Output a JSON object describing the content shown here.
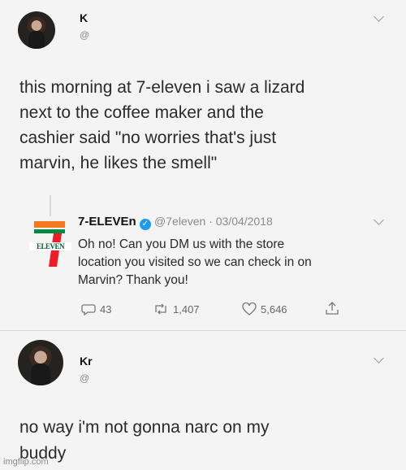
{
  "tweet1": {
    "name": "K",
    "handle": "@",
    "text_lines": [
      "this morning at 7-eleven i saw a lizard",
      "next to the coffee maker and the",
      "cashier said \"no worries that's just",
      "marvin, he likes the smell\""
    ]
  },
  "reply": {
    "logo_text": "ELEVEN",
    "name": "7-ELEVEn",
    "verified_icon": "verified-badge-icon",
    "handle_date": "@7eleven · 03/04/2018",
    "text_lines": [
      "Oh no! Can you DM us with the store",
      "location you visited so we can check in on",
      "Marvin? Thank you!"
    ],
    "metrics": {
      "replies": "43",
      "retweets": "1,407",
      "likes": "5,646"
    }
  },
  "tweet2": {
    "name": "Kr",
    "handle": "@",
    "text_lines": [
      "no way i'm not gonna narc on my",
      "buddy"
    ]
  },
  "watermark": "imgflip.com",
  "colors": {
    "background": "#f4f4f4",
    "verified": "#1d9bf0",
    "seven_orange": "#f47920",
    "seven_green": "#008a3e",
    "seven_red": "#ee1c25"
  }
}
